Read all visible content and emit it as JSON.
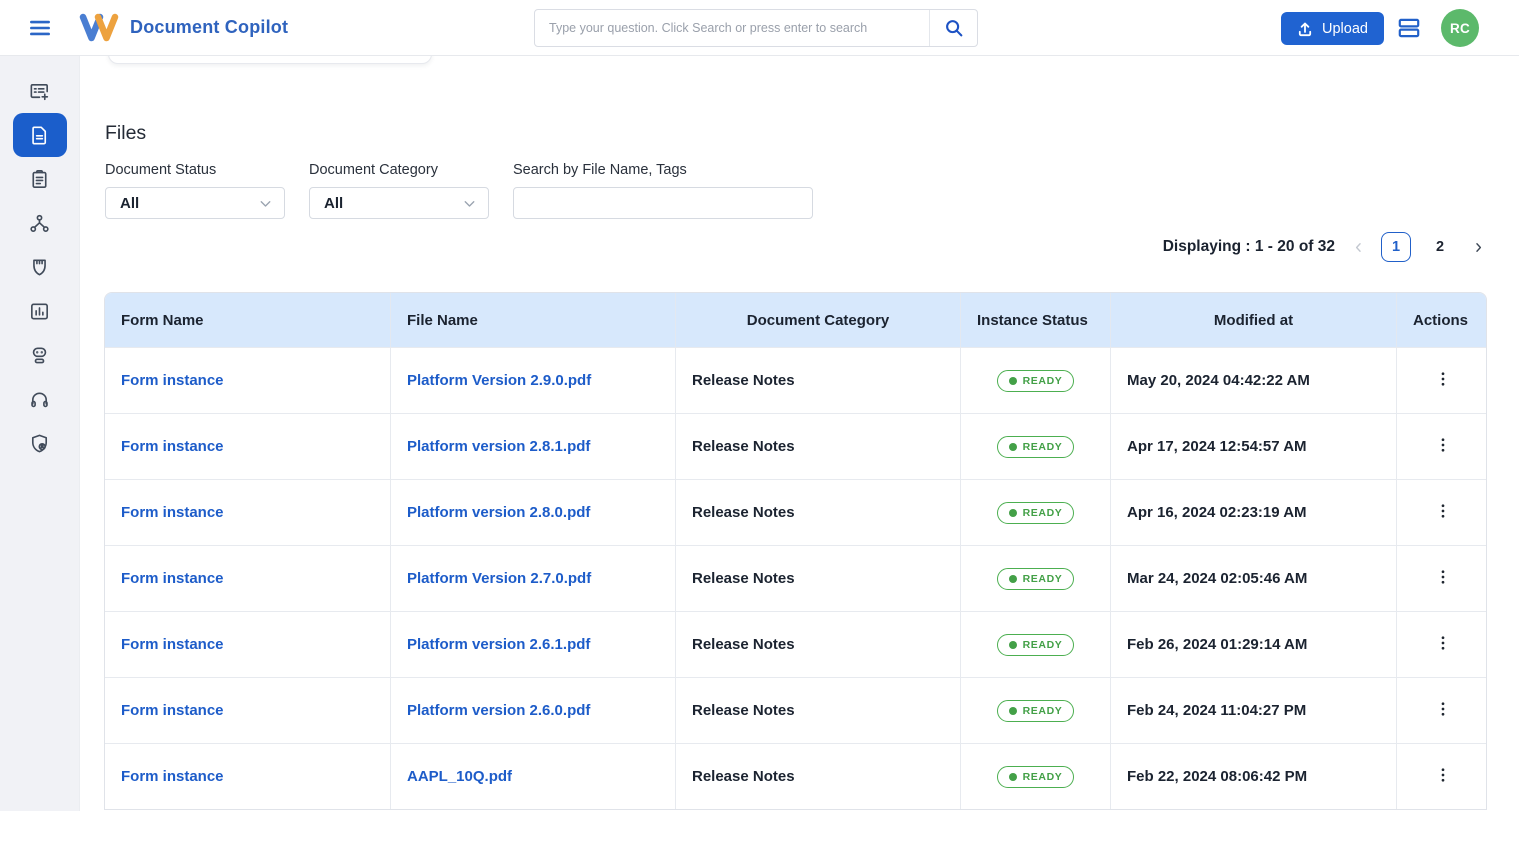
{
  "header": {
    "app_title": "Document Copilot",
    "search": {
      "placeholder": "Type your question. Click Search or press enter to search"
    },
    "upload_button": "Upload",
    "avatar_initials": "RC",
    "icons": [
      "menu-icon",
      "brand-logo",
      "search-icon",
      "upload-icon",
      "stack-icon"
    ]
  },
  "sidebar": {
    "icons": [
      "form-add",
      "documents",
      "clipboard",
      "workflow",
      "shield",
      "analytics",
      "assistant",
      "headset",
      "shield-user"
    ],
    "active": "documents"
  },
  "main": {
    "section_title": "Files",
    "filters": {
      "status_label": "Document Status",
      "status_value": "All",
      "category_label": "Document Category",
      "category_value": "All",
      "search_label": "Search by File Name, Tags",
      "search_value": ""
    },
    "pagination": {
      "display_text": "Displaying : 1 - 20 of 32",
      "pages": [
        "1",
        "2"
      ],
      "current_page": "1"
    },
    "table": {
      "columns": [
        "Form Name",
        "File Name",
        "Document Category",
        "Instance Status",
        "Modified at",
        "Actions"
      ],
      "rows": [
        {
          "form_name": "Form instance",
          "file_name": "Platform Version 2.9.0.pdf",
          "category": "Release Notes",
          "status": "READY",
          "modified_at": "May 20, 2024 04:42:22 AM"
        },
        {
          "form_name": "Form instance",
          "file_name": "Platform version 2.8.1.pdf",
          "category": "Release Notes",
          "status": "READY",
          "modified_at": "Apr 17, 2024 12:54:57 AM"
        },
        {
          "form_name": "Form instance",
          "file_name": "Platform version 2.8.0.pdf",
          "category": "Release Notes",
          "status": "READY",
          "modified_at": "Apr 16, 2024 02:23:19 AM"
        },
        {
          "form_name": "Form instance",
          "file_name": "Platform Version 2.7.0.pdf",
          "category": "Release Notes",
          "status": "READY",
          "modified_at": "Mar 24, 2024 02:05:46 AM"
        },
        {
          "form_name": "Form instance",
          "file_name": "Platform version 2.6.1.pdf",
          "category": "Release Notes",
          "status": "READY",
          "modified_at": "Feb 26, 2024 01:29:14 AM"
        },
        {
          "form_name": "Form instance",
          "file_name": "Platform version 2.6.0.pdf",
          "category": "Release Notes",
          "status": "READY",
          "modified_at": "Feb 24, 2024 11:04:27 PM"
        },
        {
          "form_name": "Form instance",
          "file_name": "AAPL_10Q.pdf",
          "category": "Release Notes",
          "status": "READY",
          "modified_at": "Feb 22, 2024 08:06:42 PM"
        }
      ]
    }
  },
  "colors": {
    "primary_blue": "#2160c9",
    "link_blue": "#1d5cc9",
    "button_blue": "#2063d1",
    "badge_green": "#43a047",
    "avatar_green": "#5cb96b",
    "table_header_bg": "#d7e8fc",
    "sidebar_bg": "#f1f2f6"
  }
}
